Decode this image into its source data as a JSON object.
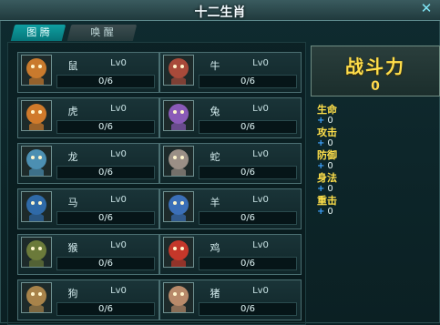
{
  "window": {
    "title": "十二生肖",
    "close_icon": "close-icon"
  },
  "tabs": [
    {
      "label": "图 腾",
      "active": true
    },
    {
      "label": "唤 醒",
      "active": false
    }
  ],
  "zodiac": [
    {
      "name": "鼠",
      "level": "Lv0",
      "progress": "0/6",
      "fraction": 0,
      "icon": "rat-portrait-icon",
      "color": "#c97a2d"
    },
    {
      "name": "牛",
      "level": "Lv0",
      "progress": "0/6",
      "fraction": 0,
      "icon": "ox-portrait-icon",
      "color": "#a84a3a"
    },
    {
      "name": "虎",
      "level": "Lv0",
      "progress": "0/6",
      "fraction": 0,
      "icon": "tiger-portrait-icon",
      "color": "#d07a2b"
    },
    {
      "name": "兔",
      "level": "Lv0",
      "progress": "0/6",
      "fraction": 0,
      "icon": "rabbit-portrait-icon",
      "color": "#8a5ab8"
    },
    {
      "name": "龙",
      "level": "Lv0",
      "progress": "0/6",
      "fraction": 0,
      "icon": "dragon-portrait-icon",
      "color": "#4c8fb2"
    },
    {
      "name": "蛇",
      "level": "Lv0",
      "progress": "0/6",
      "fraction": 0,
      "icon": "snake-portrait-icon",
      "color": "#9a8f86"
    },
    {
      "name": "马",
      "level": "Lv0",
      "progress": "0/6",
      "fraction": 0,
      "icon": "horse-portrait-icon",
      "color": "#2f6aa8"
    },
    {
      "name": "羊",
      "level": "Lv0",
      "progress": "0/6",
      "fraction": 0,
      "icon": "sheep-portrait-icon",
      "color": "#3b6fb8"
    },
    {
      "name": "猴",
      "level": "Lv0",
      "progress": "0/6",
      "fraction": 0,
      "icon": "monkey-portrait-icon",
      "color": "#6b7a3a"
    },
    {
      "name": "鸡",
      "level": "Lv0",
      "progress": "0/6",
      "fraction": 0,
      "icon": "rooster-portrait-icon",
      "color": "#c4372a"
    },
    {
      "name": "狗",
      "level": "Lv0",
      "progress": "0/6",
      "fraction": 0,
      "icon": "dog-portrait-icon",
      "color": "#a8834a"
    },
    {
      "name": "猪",
      "level": "Lv0",
      "progress": "0/6",
      "fraction": 0,
      "icon": "pig-portrait-icon",
      "color": "#b88a6a"
    }
  ],
  "power": {
    "label": "战斗力",
    "value": "0"
  },
  "stats": [
    {
      "label": "生命",
      "value": "0"
    },
    {
      "label": "攻击",
      "value": "0"
    },
    {
      "label": "防御",
      "value": "0"
    },
    {
      "label": "身法",
      "value": "0"
    },
    {
      "label": "重击",
      "value": "0"
    }
  ],
  "colors": {
    "accent": "#0f9fa1",
    "gold": "#ffde4a",
    "plus": "#3ea3ff",
    "bar_fill": "#2ac0d6"
  }
}
